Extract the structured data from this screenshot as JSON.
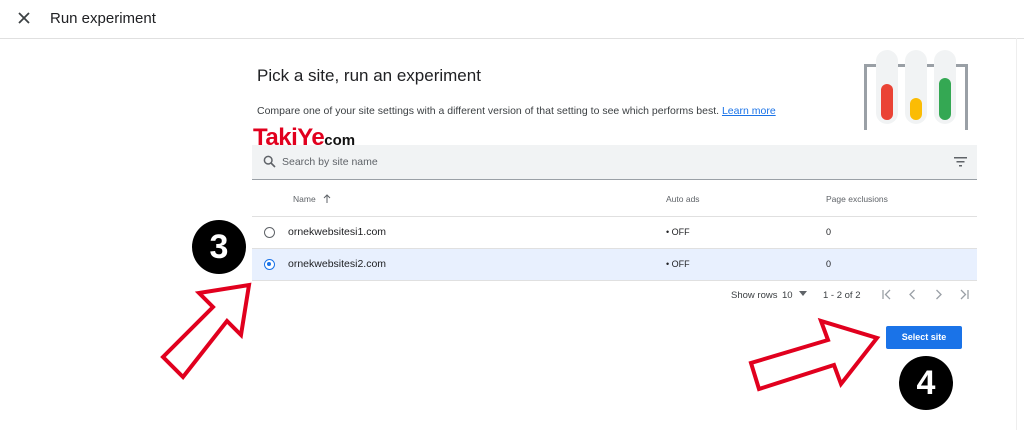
{
  "dialog": {
    "title": "Run experiment",
    "close_icon": "close-icon"
  },
  "content": {
    "heading": "Pick a site, run an experiment",
    "description": "Compare one of your site settings with a different version of that setting to see which performs best.",
    "learn_more": "Learn more",
    "illustration_icon": "test-tubes-icon"
  },
  "watermark": {
    "part1": "TakiYe",
    "part2": "com"
  },
  "search": {
    "placeholder": "Search by site name",
    "icon": "search-icon",
    "filter_icon": "filter-icon"
  },
  "table": {
    "columns": {
      "name": "Name",
      "sort_icon": "arrow-up-icon",
      "auto_ads": "Auto ads",
      "page_exclusions": "Page exclusions"
    },
    "rows": [
      {
        "name": "ornekwebsitesi1.com",
        "auto_ads": "• OFF",
        "page_exclusions": "0",
        "selected": false
      },
      {
        "name": "ornekwebsitesi2.com",
        "auto_ads": "• OFF",
        "page_exclusions": "0",
        "selected": true
      }
    ]
  },
  "pagination": {
    "show_rows_label": "Show rows",
    "rows_per_page": "10",
    "range": "1 - 2 of 2",
    "icons": [
      "first-page-icon",
      "prev-page-icon",
      "next-page-icon",
      "last-page-icon"
    ]
  },
  "actions": {
    "select_site": "Select site"
  },
  "annotations": {
    "step3": "3",
    "step4": "4",
    "arrow_color": "#e1001e"
  },
  "colors": {
    "accent": "#1a73e8",
    "selected_row": "#e8f0fe",
    "tube_red": "#ea4335",
    "tube_yellow": "#fbbc04",
    "tube_green": "#34a853"
  }
}
